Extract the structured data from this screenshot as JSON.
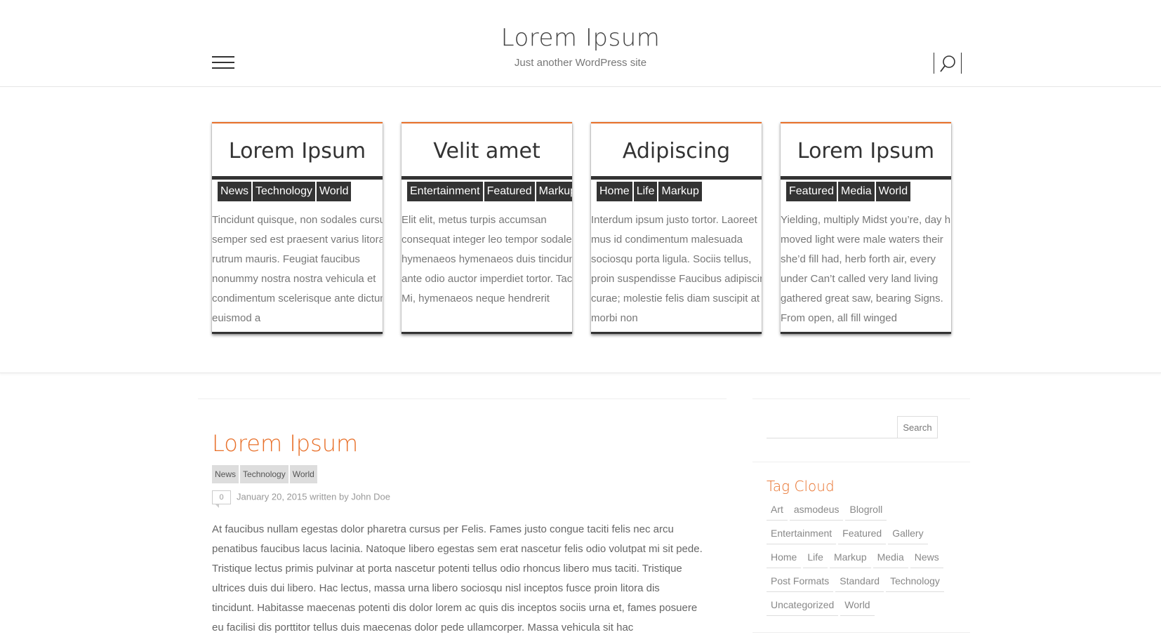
{
  "site": {
    "title": "Lorem Ipsum",
    "description": "Just another WordPress site"
  },
  "colors": {
    "accent": "#e8702a",
    "dark": "#333333",
    "text": "#777777"
  },
  "icons": {
    "menu": "hamburger-menu-icon",
    "search": "search-icon"
  },
  "featured": [
    {
      "title": "Lorem Ipsum",
      "tags": [
        "News",
        "Technology",
        "World"
      ],
      "excerpt": "Tincidunt quisque, non sodales cursus semper sed est praesent varius litora rutrum mauris. Feugiat faucibus nonummy nostra nostra vehicula et condimentum scelerisque ante dictum euismod a"
    },
    {
      "title": "Velit amet",
      "tags": [
        "Entertainment",
        "Featured",
        "Markup"
      ],
      "excerpt": "Elit elit, metus turpis accumsan consequat integer leo tempor sodales hymenaeos hymenaeos duis tincidunt ante odio auctor imperdiet tortor. Taciti Mi, hymenaeos neque hendrerit"
    },
    {
      "title": "Adipiscing",
      "tags": [
        "Home",
        "Life",
        "Markup"
      ],
      "excerpt": "Interdum ipsum justo tortor. Laoreet mus id condimentum malesuada sociosqu porta ligula. Sociis tellus, proin suspendisse Faucibus adipiscing curae; molestie felis diam suscipit at morbi non"
    },
    {
      "title": "Lorem Ipsum",
      "tags": [
        "Featured",
        "Media",
        "World"
      ],
      "excerpt": "Yielding, multiply Midst you’re, day him moved light were male waters their she’d fill had, herb forth air, every under Can’t called very land living gathered great saw, bearing Signs. From open, all fill winged"
    }
  ],
  "post": {
    "title": "Lorem Ipsum",
    "tags": [
      "News",
      "Technology",
      "World"
    ],
    "comments": "0",
    "meta": "January 20, 2015 written by John Doe",
    "body": "At faucibus nullam egestas dolor pharetra cursus per Felis. Fames justo congue taciti felis nec arcu penatibus faucibus lacus lacinia. Natoque libero egestas sem erat nascetur felis odio volutpat mi sit pede. Tristique lectus primis pulvinar at porta nascetur potenti tellus odio rhoncus libero mus taciti. Tristique ultrices duis dui libero. Hac lectus, massa urna libero sociosqu nisl inceptos fusce proin litora dis tincidunt. Habitasse maecenas potenti dis dolor lorem ac quis dis inceptos sociis urna et, fames posuere eu facilisi dis porttitor tellus duis maecenas dolor pede ullamcorper. Massa vehicula sit hac"
  },
  "sidebar": {
    "search_button": "Search",
    "search_placeholder": "",
    "tagcloud_title": "Tag Cloud",
    "tags": [
      "Art",
      "asmodeus",
      "Blogroll",
      "Entertainment",
      "Featured",
      "Gallery",
      "Home",
      "Life",
      "Markup",
      "Media",
      "News",
      "Post Formats",
      "Standard",
      "Technology",
      "Uncategorized",
      "World"
    ]
  }
}
